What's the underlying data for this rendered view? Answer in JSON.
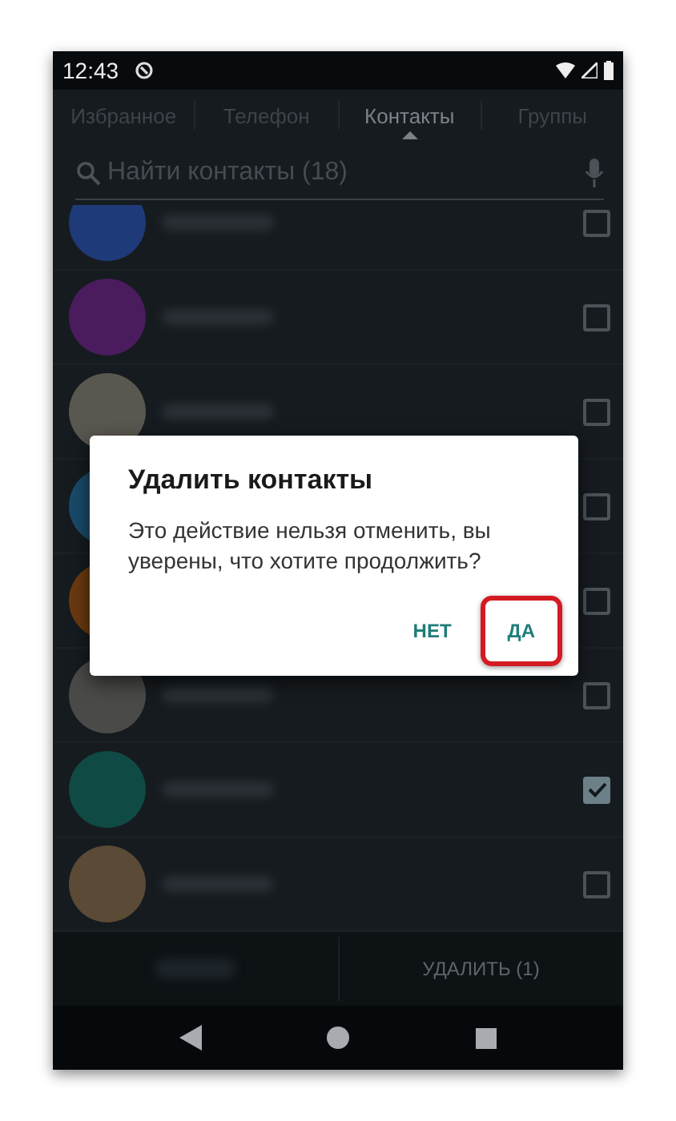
{
  "status_bar": {
    "time": "12:43"
  },
  "tabs": [
    {
      "label": "Избранное",
      "selected": false
    },
    {
      "label": "Телефон",
      "selected": false
    },
    {
      "label": "Контакты",
      "selected": true
    },
    {
      "label": "Группы",
      "selected": false
    }
  ],
  "search": {
    "placeholder": "Найти контакты (18)"
  },
  "contacts": [
    {
      "color": "#1f3a78",
      "checked": false
    },
    {
      "color": "#4a1c5e",
      "checked": false
    },
    {
      "color": "#5a5750",
      "checked": false
    },
    {
      "color": "#1a4a6a",
      "checked": false
    },
    {
      "color": "#6a3a10",
      "checked": false
    },
    {
      "color": "#4a4a48",
      "checked": false
    },
    {
      "color": "#0f4a44",
      "checked": true
    },
    {
      "color": "#5a4a36",
      "checked": false
    }
  ],
  "bottom_bar": {
    "delete_label": "УДАЛИТЬ (1)"
  },
  "dialog": {
    "title": "Удалить контакты",
    "message": "Это действие нельзя отменить, вы уверены, что хотите продолжить?",
    "buttons": [
      {
        "label": "НЕТ",
        "annotated": false
      },
      {
        "label": "ДА",
        "annotated": true
      }
    ]
  }
}
